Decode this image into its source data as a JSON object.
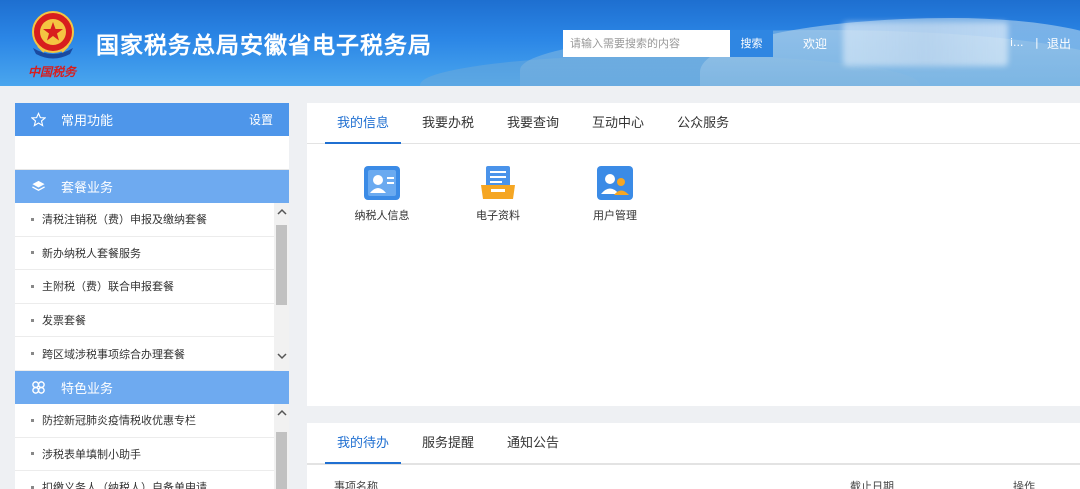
{
  "header": {
    "emblem_subtitle": "中国税务",
    "site_title": "国家税务总局安徽省电子税务局",
    "search_placeholder": "请输入需要搜索的内容",
    "search_button": "搜索",
    "welcome": "欢迎",
    "user_name_suffix": "i...",
    "separator": "|",
    "logout": "退出"
  },
  "sidebar": {
    "common": {
      "title": "常用功能",
      "settings": "设置",
      "icon": "star-icon"
    },
    "package": {
      "title": "套餐业务",
      "icon": "layers-icon",
      "items": [
        "清税注销税（费）申报及缴纳套餐",
        "新办纳税人套餐服务",
        "主附税（费）联合申报套餐",
        "发票套餐",
        "跨区域涉税事项综合办理套餐"
      ]
    },
    "featured": {
      "title": "特色业务",
      "icon": "clover-icon",
      "items": [
        "防控新冠肺炎疫情税收优惠专栏",
        "涉税表单填制小助手",
        "扣缴义务人（纳税人）自备单申请"
      ]
    }
  },
  "main_tabs": [
    "我的信息",
    "我要办税",
    "我要查询",
    "互动中心",
    "公众服务"
  ],
  "apps": [
    {
      "label": "纳税人信息",
      "icon": "taxpayer-card-icon"
    },
    {
      "label": "电子资料",
      "icon": "document-tray-icon"
    },
    {
      "label": "用户管理",
      "icon": "users-icon"
    }
  ],
  "bottom_tabs": [
    "我的待办",
    "服务提醒",
    "通知公告"
  ],
  "todo_table": {
    "col_name": "事项名称",
    "col_deadline": "截止日期",
    "col_action": "操作"
  },
  "colors": {
    "accent": "#1f6fd1",
    "sidebar_head": "#6eaaf0",
    "header_blue": "#2b86e6"
  }
}
